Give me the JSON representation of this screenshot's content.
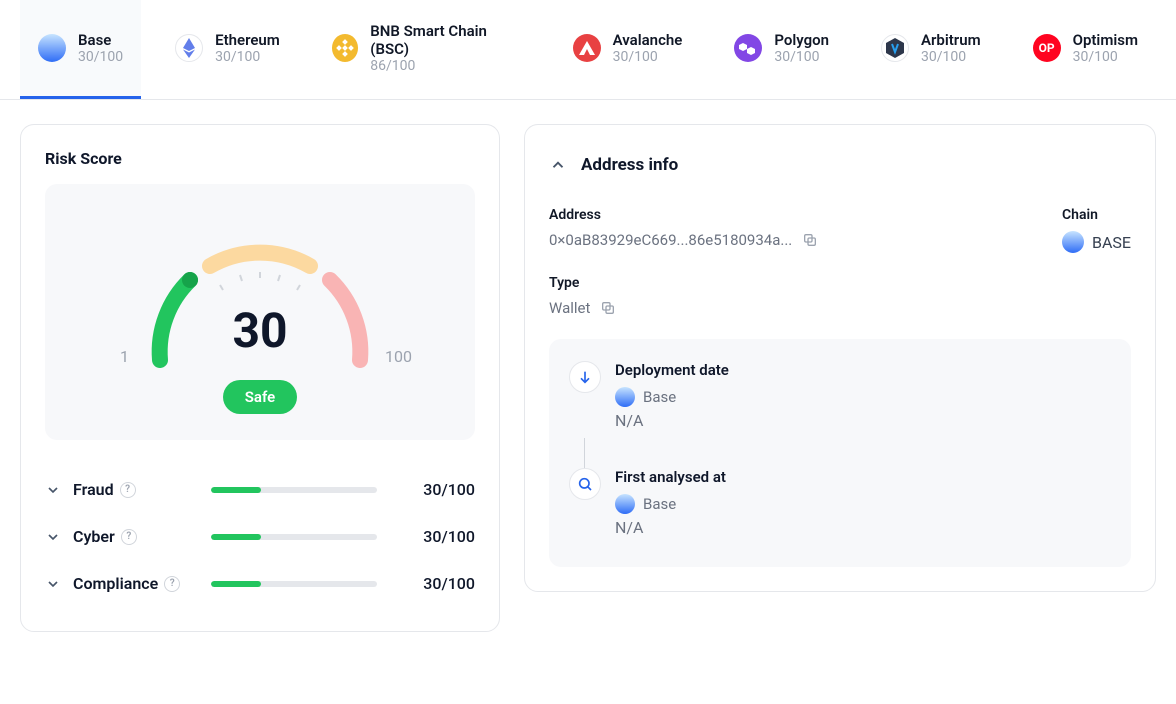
{
  "tabs": [
    {
      "name": "Base",
      "score": "30/100",
      "iconClass": "icon-base"
    },
    {
      "name": "Ethereum",
      "score": "30/100",
      "iconClass": "icon-eth"
    },
    {
      "name": "BNB Smart Chain (BSC)",
      "score": "86/100",
      "iconClass": "icon-bnb"
    },
    {
      "name": "Avalanche",
      "score": "30/100",
      "iconClass": "icon-avax"
    },
    {
      "name": "Polygon",
      "score": "30/100",
      "iconClass": "icon-polygon"
    },
    {
      "name": "Arbitrum",
      "score": "30/100",
      "iconClass": "icon-arbitrum"
    },
    {
      "name": "Optimism",
      "score": "30/100",
      "iconClass": "icon-optimism"
    }
  ],
  "riskScore": {
    "title": "Risk Score",
    "value": "30",
    "min": "1",
    "max": "100",
    "badge": "Safe"
  },
  "metrics": [
    {
      "name": "Fraud",
      "score": "30/100",
      "pct": 30
    },
    {
      "name": "Cyber",
      "score": "30/100",
      "pct": 30
    },
    {
      "name": "Compliance",
      "score": "30/100",
      "pct": 30
    }
  ],
  "addressInfo": {
    "title": "Address info",
    "addressLabel": "Address",
    "addressValue": "0×0aB83929eC669...86e5180934a...",
    "chainLabel": "Chain",
    "chainValue": "BASE",
    "typeLabel": "Type",
    "typeValue": "Wallet"
  },
  "timeline": [
    {
      "title": "Deployment date",
      "chain": "Base",
      "value": "N/A",
      "iconColor": "#2563eb",
      "iconGlyph": "↓"
    },
    {
      "title": "First analysed at",
      "chain": "Base",
      "value": "N/A",
      "iconColor": "#2563eb",
      "iconGlyph": "search"
    }
  ]
}
